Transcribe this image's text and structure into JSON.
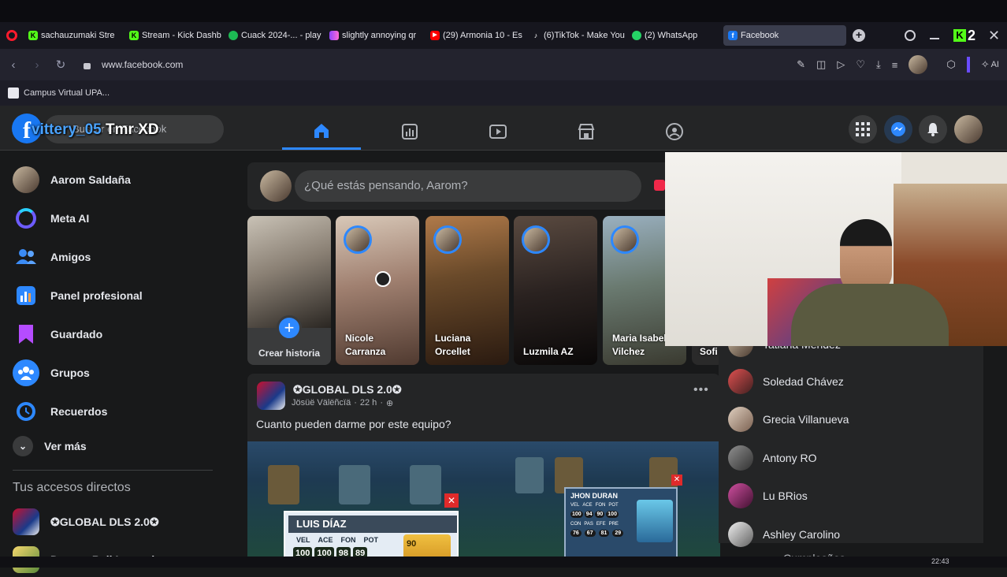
{
  "browser": {
    "tabs": [
      {
        "label": "sachauzumaki Stre",
        "icon": "kick-icon",
        "color": "#53fc18"
      },
      {
        "label": "Stream - Kick Dashb",
        "icon": "kick-icon",
        "color": "#53fc18"
      },
      {
        "label": "Cuack 2024-... - play",
        "icon": "spotify-icon",
        "color": "#1db954"
      },
      {
        "label": "slightly annoying qr",
        "icon": "twitch-icon",
        "color": "#9146ff"
      },
      {
        "label": "(29) Armonia 10 - Es",
        "icon": "youtube-icon",
        "color": "#ff0000"
      },
      {
        "label": "(6)TikTok - Make You",
        "icon": "tiktok-icon",
        "color": "#ffffff"
      },
      {
        "label": "(2) WhatsApp",
        "icon": "whatsapp-icon",
        "color": "#25d366"
      },
      {
        "label": "Facebook",
        "icon": "facebook-icon",
        "color": "#1877f2"
      }
    ],
    "kick_count": "2",
    "url": "www.facebook.com",
    "bookmark": "Campus Virtual UPA...",
    "ai_label": "AI"
  },
  "stream_overlay": {
    "name_part1": "vittery_05",
    "name_part2": "Tmr XD"
  },
  "fb_header": {
    "logo": "f",
    "search_placeholder": "Buscar en Facebook"
  },
  "left_nav": {
    "items": [
      {
        "label": "Aarom Saldaña",
        "icon": "user-avatar"
      },
      {
        "label": "Meta AI",
        "icon": "meta-ai-icon"
      },
      {
        "label": "Amigos",
        "icon": "friends-icon"
      },
      {
        "label": "Panel profesional",
        "icon": "dashboard-icon"
      },
      {
        "label": "Guardado",
        "icon": "bookmark-icon"
      },
      {
        "label": "Grupos",
        "icon": "groups-icon"
      },
      {
        "label": "Recuerdos",
        "icon": "clock-icon"
      }
    ],
    "see_more": "Ver más",
    "shortcuts_title": "Tus accesos directos",
    "shortcuts": [
      {
        "label": "✪GLOBAL DLS 2.0✪"
      },
      {
        "label": "Dragon Ball Legends"
      }
    ]
  },
  "composer": {
    "placeholder": "¿Qué estás pensando, Aarom?"
  },
  "stories": [
    {
      "name": "Crear historia",
      "create": true
    },
    {
      "name": "Nicole Carranza"
    },
    {
      "name": "Luciana Orcellet"
    },
    {
      "name": "Luzmila AZ"
    },
    {
      "name": "Maria Isabel Vilchez"
    },
    {
      "name": "Sofi"
    }
  ],
  "post": {
    "group": "✪GLOBAL DLS 2.0✪",
    "author": "Jösüë Välëñcïä",
    "time": "22 h",
    "text": "Cuanto pueden darme por este equipo?",
    "card1": {
      "name": "LUIS DÍAZ",
      "stats_labels": [
        "VEL",
        "ACE",
        "FON",
        "POT"
      ],
      "stats": [
        "100",
        "100",
        "98",
        "89"
      ],
      "rating": "90"
    },
    "card2": {
      "name": "JHON DURAN",
      "stats_labels": [
        "VEL",
        "ACE",
        "FON",
        "POT"
      ],
      "stats": [
        "100",
        "94",
        "90",
        "100"
      ],
      "stats_labels2": [
        "CON",
        "PAS",
        "EFE",
        "PRE"
      ],
      "stats2": [
        "76",
        "67",
        "81",
        "29"
      ]
    }
  },
  "contacts": [
    {
      "name": "Tatiana Mendez"
    },
    {
      "name": "Soledad Chávez"
    },
    {
      "name": "Grecia Villanueva"
    },
    {
      "name": "Antony RO"
    },
    {
      "name": "Lu BRios"
    },
    {
      "name": "Ashley Carolino"
    }
  ],
  "birthdays_label": "Cumpleaños",
  "clock": "22:43",
  "colors": {
    "fb_blue": "#1877f2",
    "accent": "#2d88ff"
  }
}
